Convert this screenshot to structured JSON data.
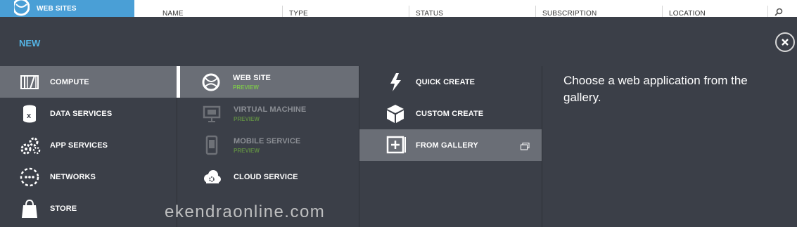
{
  "topbar": {
    "section_label": "WEB SITES",
    "section_color": "#4a9fd6",
    "columns": [
      "NAME",
      "TYPE",
      "STATUS",
      "SUBSCRIPTION",
      "LOCATION"
    ],
    "search_icon": "search-icon"
  },
  "panel": {
    "title": "NEW",
    "title_color": "#55b5e6",
    "close_icon": "close-icon"
  },
  "categories": [
    {
      "label": "COMPUTE",
      "icon": "compute-icon",
      "selected": true
    },
    {
      "label": "DATA SERVICES",
      "icon": "database-icon",
      "selected": false
    },
    {
      "label": "APP SERVICES",
      "icon": "gears-icon",
      "selected": false
    },
    {
      "label": "NETWORKS",
      "icon": "network-icon",
      "selected": false
    },
    {
      "label": "STORE",
      "icon": "shopping-bag-icon",
      "selected": false
    }
  ],
  "services": [
    {
      "label": "WEB SITE",
      "badge": "PREVIEW",
      "icon": "globe-icon",
      "selected": true,
      "enabled": true
    },
    {
      "label": "VIRTUAL MACHINE",
      "badge": "PREVIEW",
      "icon": "monitor-icon",
      "selected": false,
      "enabled": false
    },
    {
      "label": "MOBILE SERVICE",
      "badge": "PREVIEW",
      "icon": "phone-icon",
      "selected": false,
      "enabled": false
    },
    {
      "label": "CLOUD SERVICE",
      "badge": "",
      "icon": "cloud-gear-icon",
      "selected": false,
      "enabled": true
    }
  ],
  "create_options": [
    {
      "label": "QUICK CREATE",
      "icon": "lightning-icon",
      "selected": false
    },
    {
      "label": "CUSTOM CREATE",
      "icon": "box-icon",
      "selected": false
    },
    {
      "label": "FROM GALLERY",
      "icon": "gallery-add-icon",
      "selected": true,
      "extra_icon": "open-window-icon"
    }
  ],
  "description": "Choose a web application from the gallery.",
  "watermark": "ekendraonline.com",
  "colors": {
    "panel_bg": "#3b3f48",
    "selected_bg": "#6a6e76",
    "preview_green": "#7cc04f"
  }
}
